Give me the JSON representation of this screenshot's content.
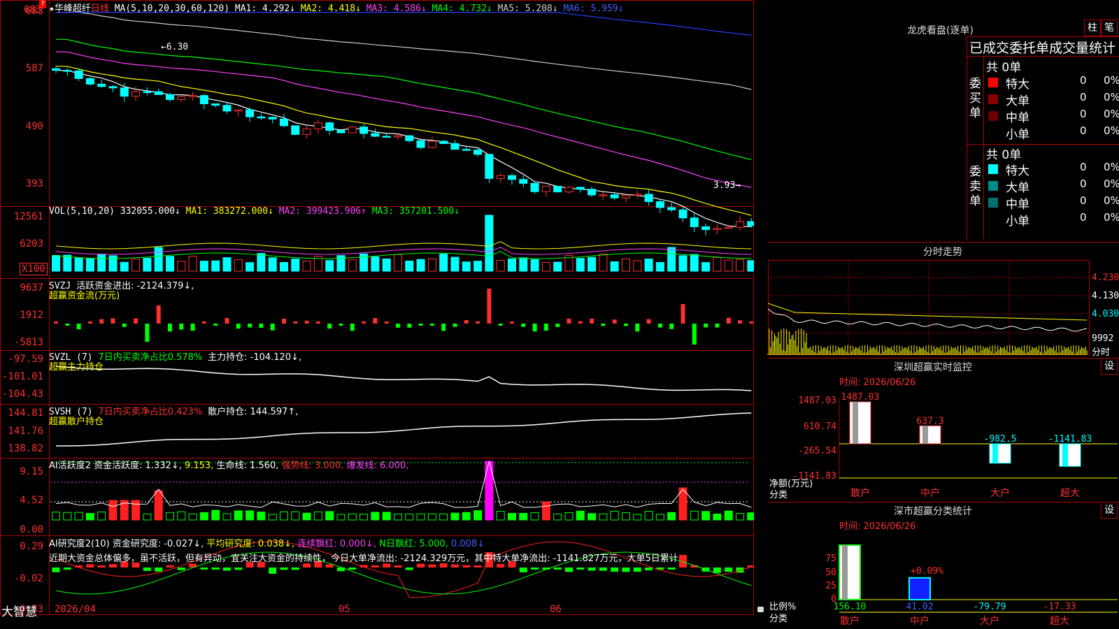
{
  "app": {
    "brand": "大智慧"
  },
  "kline": {
    "top_left_marker": "683",
    "stock_name": "华峰超纤",
    "period": "日线",
    "ma_header": "MA(5,10,20,30,60,120)",
    "ma1": "MA1: 4.292↓",
    "ma2": "MA2: 4.418↓",
    "ma3": "MA3: 4.586↓",
    "ma4": "MA4: 4.732↓",
    "ma5": "MA5: 5.208↓",
    "ma6": "MA6: 5.959↓",
    "y_labels": [
      "683",
      "587",
      "490",
      "393"
    ],
    "high_label": "6.30",
    "low_label": "3.93",
    "question_mark": "?"
  },
  "vol": {
    "header": "VOL(5,10,20)",
    "value": "332055.000↓",
    "ma1": "MA1: 383272.000↓",
    "ma2": "MA2: 399423.906↑",
    "ma3": "MA3: 357201.500↓",
    "y_labels": [
      "12561",
      "6203",
      "X100"
    ]
  },
  "svzj": {
    "name": "SVZJ",
    "label": "活跃资金进出: -2124.379↓,",
    "subtitle": "超赢资金流(万元)",
    "y_labels": [
      "9637",
      "1912",
      "-5813"
    ]
  },
  "svzl": {
    "name": "SVZL (7)",
    "ratio": "7日内买卖净占比0.578%",
    "hold": "主力持仓: -104.120↓,",
    "subtitle": "超赢主力持仓",
    "y_labels": [
      "-97.59",
      "-101.01",
      "-104.43"
    ]
  },
  "svsh": {
    "name": "SVSH (7)",
    "ratio": "7日内买卖净占比0.423%",
    "hold": "散户持仓: 144.597↑,",
    "subtitle": "超赢散户持仓",
    "y_labels": [
      "144.81",
      "141.76",
      "138.82"
    ]
  },
  "ai_active": {
    "name": "AI活跃度2",
    "activity": "资金活跃度: 1.332↓,",
    "v2": "9.153,",
    "life": "生命线: 1.560,",
    "strong": "强势线: 3.000,",
    "burst": "爆发线: 6.000,",
    "y_labels": [
      "9.15",
      "4.52",
      "0.00"
    ]
  },
  "ai_research": {
    "name": "AI研究度2(10)",
    "research": "资金研究度: -0.027↓,",
    "avg": "平均研究度: 0.038↓,",
    "cont": "连续飘红: 0.000↓,",
    "nday": "N日飘红: 5.000,",
    "last": "0.008↓",
    "comment": "近期大资金总体偏多，虽不活跃，但有异动，宜关注大资金的持续性，今日大单净流出: -2124.329万元，其中特大单净流出: -1141.827万元，大单5日累计",
    "y_labels": [
      "0.29",
      "-0.02",
      "-0.33"
    ]
  },
  "xaxis": {
    "labels": [
      "2026/04",
      "05",
      "06"
    ]
  },
  "dragon": {
    "title": "龙虎看盘(逐单)",
    "btn1": "柱",
    "btn2": "笔",
    "header": "已成交委托单成交量统计",
    "buy_label": "委买单",
    "sell_label": "委卖单",
    "buy_total": "共 0单",
    "sell_total": "共 0单",
    "buy_rows": [
      {
        "name": "特大",
        "count": "0",
        "pct": "0%",
        "color": "#ff0000"
      },
      {
        "name": "大单",
        "count": "0",
        "pct": "0%",
        "color": "#8b0000"
      },
      {
        "name": "中单",
        "count": "0",
        "pct": "0%",
        "color": "#6b0000"
      },
      {
        "name": "小单",
        "count": "0",
        "pct": "0%",
        "color": "#000000"
      }
    ],
    "sell_rows": [
      {
        "name": "特大",
        "count": "0",
        "pct": "0%",
        "color": "#00ffff"
      },
      {
        "name": "大单",
        "count": "0",
        "pct": "0%",
        "color": "#008b8b"
      },
      {
        "name": "中单",
        "count": "0",
        "pct": "0%",
        "color": "#007070"
      },
      {
        "name": "小单",
        "count": "0",
        "pct": "0%",
        "color": "#000000"
      }
    ]
  },
  "intraday": {
    "title": "分时走势",
    "y_labels": [
      "4.230",
      "4.130",
      "4.030",
      "9992"
    ],
    "sub": "分时"
  },
  "monitor": {
    "title": "深圳超赢实时监控",
    "btn": "设",
    "time": "时间: 2026/06/26",
    "y_labels": [
      "1487.03",
      "610.74",
      "-265.54",
      "-1141.83"
    ],
    "unit": "净额(万元)",
    "cat": "分类",
    "bars": [
      {
        "name": "散户",
        "value": 1487.03,
        "label": "1487.03"
      },
      {
        "name": "中户",
        "value": 637.3,
        "label": "637.3"
      },
      {
        "name": "大户",
        "value": -982.5,
        "label": "-982.5"
      },
      {
        "name": "超大",
        "value": -1141.83,
        "label": "-1141.83"
      }
    ]
  },
  "classify": {
    "title": "深市超赢分类统计",
    "btn": "设",
    "time": "时间: 2026/06/26",
    "y_labels": [
      "75",
      "50",
      "25",
      "0"
    ],
    "unit": "比例%",
    "cat": "分类",
    "pct_label": "+0.09%",
    "bars": [
      {
        "name": "散户",
        "label": "156.10",
        "pct": 100
      },
      {
        "name": "中户",
        "label": "41.02",
        "pct": 40
      },
      {
        "name": "大户",
        "label": "-79.79",
        "pct": 0
      },
      {
        "name": "超大",
        "label": "-17.33",
        "pct": 0
      }
    ]
  }
}
